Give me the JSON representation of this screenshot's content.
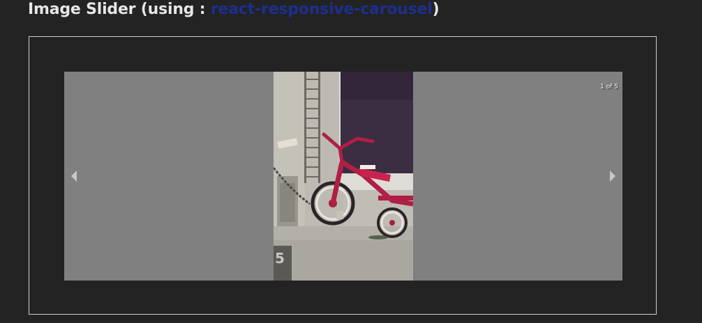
{
  "header": {
    "title_prefix": "Image Slider (using : ",
    "link_text": "react-responsive-carousel",
    "title_suffix": ")"
  },
  "carousel": {
    "status": "1 of 5",
    "current_slide": 1,
    "total_slides": 5,
    "slide_image": "tricycle-photo",
    "prev_icon": "chevron-left-icon",
    "next_icon": "chevron-right-icon"
  },
  "photo": {
    "curb_number": "5"
  },
  "colors": {
    "page_background": "#232323",
    "heading_text": "#e6e6e6",
    "link": "#1c2f8f",
    "carousel_background": "#808080",
    "frame_border": "#cfcfcf"
  }
}
